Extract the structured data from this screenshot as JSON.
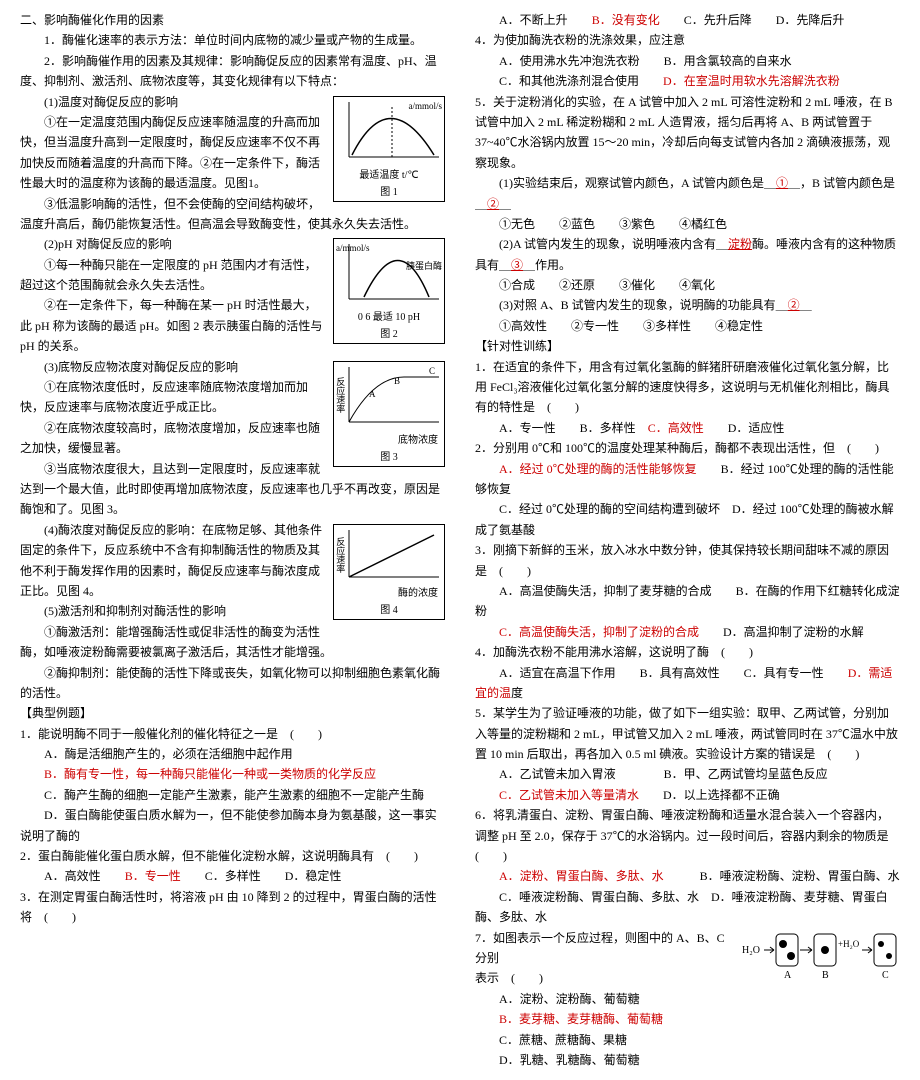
{
  "left": {
    "h2": "二、影响酶催化作用的因素",
    "p1": "　　1．酶催化速率的表示方法：单位时间内底物的减少量或产物的生成量。",
    "p2": "　　2．影响酶催作用的因素及其规律：影响酶促反应的因素常有温度、pH、温度、抑制剂、激活剂、底物浓度等，其变化规律有以下特点：",
    "s1": "　　(1)温度对酶促反应的影响",
    "p3": "　　①在一定温度范围内酶促反应速率随温度的升高而加快，但当温度升高到一定限度时，酶促反应速率不仅不再加快反而随着温度的升高而下降。②在一定条件下，酶活性最大时的温度称为该酶的最适温度。见图1。",
    "p4": "　　③低温影响酶的活性，但不会使酶的空间结构破坏，温度升高后，酶仍能恢复活性。但高温会导致酶变性，使其永久失去活性。",
    "s2": "　　(2)pH 对酶促反应的影响",
    "p5": "　　①每一种酶只能在一定限度的 pH 范围内才有活性，超过这个范围酶就会永久失去活性。",
    "p6": "　　②在一定条件下，每一种酶在某一 pH 时活性最大，此 pH 称为该酶的最适 pH。如图 2 表示胰蛋白酶的活性与 pH 的关系。",
    "s3": "　　(3)底物反应物浓度对酶促反应的影响",
    "p7": "　　①在底物浓度低时，反应速率随底物浓度增加而加快，反应速率与底物浓度近乎成正比。",
    "p8": "　　②在底物浓度较高时，底物浓度增加，反应速率也随之加快，缓慢显著。",
    "p9": "　　③当底物浓度很大，且达到一定限度时，反应速率就达到一个最大值，此时即使再增加底物浓度，反应速率也几乎不再改变，原因是酶饱和了。见图 3。",
    "s4": "　　(4)酶浓度对酶促反应的影响：在底物足够、其他条件固定的条件下，反应系统中不含有抑制酶活性的物质及其他不利于酶发挥作用的因素时，酶促反应速率与酶浓度成正比。见图 4。",
    "s5": "　　(5)激活剂和抑制剂对酶活性的影响",
    "p10": "　　①酶激活剂：能增强酶活性或促非活性的酶变为活性酶，如唾液淀粉酶需要被氯离子激活后，其活性才能增强。",
    "p11": "　　②酶抑制剂：能使酶的活性下降或丧失，如氧化物可以抑制细胞色素氧化酶的活性。",
    "hdt": "【典型例题】",
    "q1a": "1．能说明酶不同于一般催化剂的催化特征之一是　(　　)",
    "q1b": "　　A．酶是活细胞产生的，必须在活细胞中起作用",
    "q1c": "　　B．酶有专一性，每一种酶只能催化一种或一类物质的化学反应",
    "q1d": "　　C．酶产生酶的细胞一定能产生激素，能产生激素的细胞不一定能产生酶",
    "q1e": "　　D．蛋白酶能使蛋白质水解为一，但不能使参加酶本身为氨基酸，这一事实说明了酶的",
    "q2a": "2．蛋白酶能催化蛋白质水解，但不能催化淀粉水解，这说明酶具有　(　　)",
    "q2b": "　　A．高效性",
    "q2c": "B．专一性",
    "q2d": "　　C．多样性　　D．稳定性",
    "q3a": "3．在测定胃蛋白酶活性时，将溶液 pH 由 10 降到 2 的过程中，胃蛋白酶的活性将　(　　)",
    "fig1": "图 1",
    "fig1x": "最适温度  t/℃",
    "fig1y": "a/mmol/s",
    "fig2": "图 2",
    "fig2x": "0    6  最适 10  pH",
    "fig2y": "胰蛋白酶",
    "fig2yl": "a/mmol/s",
    "fig3": "图 3",
    "fig3x": "底物浓度",
    "fig3y": "反应速率",
    "fig4": "图 4",
    "fig4x": "酶的浓度",
    "fig4y": "反应速率"
  },
  "right": {
    "q3b": "　　A．不断上升",
    "q3c": "B．没有变化",
    "q3d": "　　C．先升后降　　D．先降后升",
    "q4a": "4．为使加酶洗衣粉的洗涤效果，应注意",
    "q4b": "　　A．使用沸水先冲泡洗衣粉　　B．用含氯较高的自来水",
    "q4c": "　　C．和其他洗涤剂混合使用",
    "q4d": "D．在室温时用软水先溶解洗衣粉",
    "q5a": "5．关于淀粉消化的实验，在 A 试管中加入 2 mL 可溶性淀粉和 2 mL 唾液，在 B 试管中加入 2 mL 稀淀粉糊和 2 mL 人造胃液，摇匀后再将 A、B 两试管置于 37~40℃水浴锅内放置 15～20 min，冷却后向每支试管内各加 2 滴碘液振荡，观察现象。",
    "q5b": "　　(1)实验结束后，观察试管内颜色，A 试管内颜色是＿",
    "q5b2": "①",
    "q5b3": "＿，B 试管内颜色是＿",
    "q5b4": "②",
    "q5b5": "＿",
    "q5c": "　　①无色　　②蓝色　　③紫色　　④橘红色",
    "q5d": "　　(2)A 试管内发生的现象，说明唾液内含有＿",
    "q5d2": "淀粉",
    "q5d3": "酶。唾液内含有的这种物质具有＿",
    "q5d4": "③",
    "q5d5": "＿作用。",
    "q5e": "　　①合成　　②还原　　③催化　　④氧化",
    "q5f": "　　(3)对照 A、B 试管内发生的现象，说明酶的功能具有＿",
    "q5f2": "②",
    "q5f3": "＿",
    "q5g": "　　①高效性　　②专一性　　③多样性　　④稳定性",
    "hdx": "【针对性训练】",
    "t1a": "1．在适宜的条件下，用含有过氧化氢酶的鲜猪肝研磨液催化过氧化氢分解，比用 FeCl₃溶液催化过氧化氢分解的速度快得多，这说明与无机催化剂相比，酶具有的特性是　(　　)",
    "t1b": "　　A．专一性　　B．多样性",
    "t1c": "C．高效性",
    "t1d": "　　D．适应性",
    "t2a": "2．分别用 0℃和 100℃的温度处理某种酶后，酶都不表现出活性，但　(　　)",
    "t2b": "　　A．经过 0℃处理的酶的活性能够恢复",
    "t2c": "　　B．经过 100℃处理的酶的活性能够恢复",
    "t2d": "　　C．经过 0℃处理的酶的空间结构遭到破坏　D．经过 100℃处理的酶被水解成了氨基酸",
    "t3a": "3．刚摘下新鲜的玉米，放入冰水中数分钟，使其保持较长期间甜味不减的原因是　(　　)",
    "t3b": "　　A．高温使酶失活，抑制了麦芽糖的合成　　B．在酶的作用下红糖转化成淀粉",
    "t3c": "　　C．高温使酶失活，抑制了淀粉的合成",
    "t3d": "　　D．高温抑制了淀粉的水解",
    "t4a": "4．加酶洗衣粉不能用沸水溶解，这说明了酶　(　　)",
    "t4b": "　　A．适宜在高温下作用　　B．具有高效性　　C．具有专一性",
    "t4c": "D．需适宜的温",
    "t4d": "度",
    "t5a": "5．某学生为了验证唾液的功能，做了如下一组实验：取甲、乙两试管，分别加入等量的淀粉糊和 2 mL，甲试管又加入 2 mL 唾液，两试管同时在 37℃温水中放置 10 min 后取出，再各加入 0.5 ml 碘液。实验设计方案的错误是　(　　)",
    "t5b": "　　A．乙试管未加入胃液　　　　B．甲、乙两试管均呈蓝色反应",
    "t5c": "　　C．乙试管未加入等量清水",
    "t5d": "　　D．以上选择都不正确",
    "t6a": "6．将乳清蛋白、淀粉、胃蛋白酶、唾液淀粉酶和适量水混合装入一个容器内，调整 pH 至 2.0，保存于 37℃的水浴锅内。过一段时间后，容器内剩余的物质是　(　　)",
    "t6b": "　　A．淀粉、胃蛋白酶、多肽、水",
    "t6c": "　　　B．唾液淀粉酶、淀粉、胃蛋白酶、水",
    "t6d": "　　C．唾液淀粉酶、胃蛋白酶、多肽、水　D．唾液淀粉酶、麦芽糖、胃蛋白酶、多肽、水",
    "t7a": "7．如图表示一个反应过程，则图中的 A、B、C　　　　　　　　　　　　　　　　　　　分别",
    "t7b": "表示　(　　)",
    "t7c": "　　A．淀粉、淀粉酶、葡萄糖",
    "t7d": "　　B．麦芽糖、麦芽糖酶、葡萄糖",
    "t7e": "　　C．蔗糖、蔗糖酶、果糖",
    "t7f": "　　D．乳糖、乳糖酶、葡萄糖",
    "dA": "A",
    "dB": "B",
    "dC": "C",
    "dH": "H₂O"
  }
}
